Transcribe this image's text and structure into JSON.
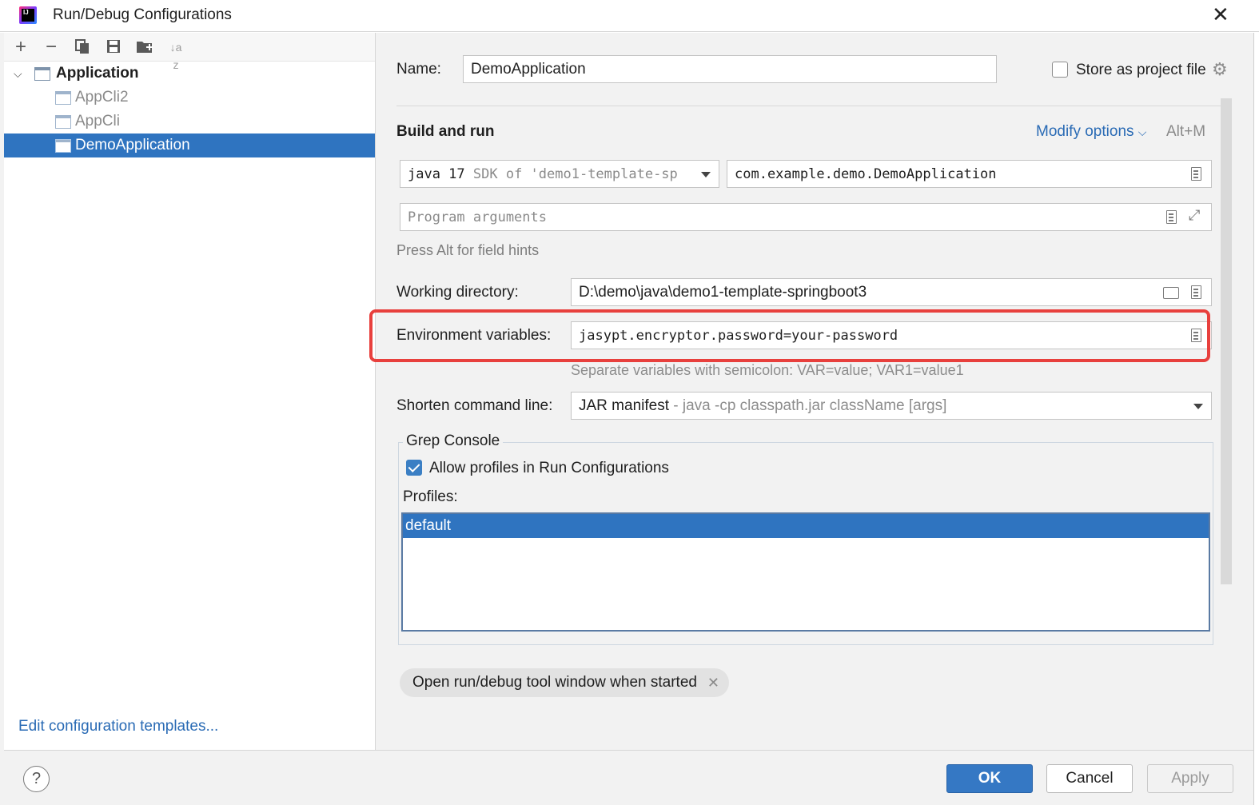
{
  "window": {
    "title": "Run/Debug Configurations",
    "app_icon_text": "IJ"
  },
  "toolbar": {
    "add": "+",
    "remove": "−",
    "copy": "⧉",
    "save": "💾",
    "folder": "📁",
    "sort": "↓a z"
  },
  "tree": {
    "group": "Application",
    "items": [
      {
        "label": "AppCli2"
      },
      {
        "label": "AppCli"
      },
      {
        "label": "DemoApplication"
      }
    ]
  },
  "left_footer": {
    "edit_templates": "Edit configuration templates..."
  },
  "form": {
    "name_label": "Name:",
    "name_value": "DemoApplication",
    "store_label": "Store as project file",
    "store_checked": false,
    "section_title": "Build and run",
    "modify_options": "Modify options",
    "modify_shortcut": "Alt+M",
    "sdk_value": "java 17",
    "sdk_detail": "SDK of 'demo1-template-sp",
    "main_class": "com.example.demo.DemoApplication",
    "program_args_placeholder": "Program arguments",
    "alt_hint": "Press Alt for field hints",
    "workdir_label": "Working directory:",
    "workdir_value": "D:\\demo\\java\\demo1-template-springboot3",
    "env_label": "Environment variables:",
    "env_value": "jasypt.encryptor.password=your-password",
    "env_hint": "Separate variables with semicolon: VAR=value; VAR1=value1",
    "shorten_label": "Shorten command line:",
    "shorten_value": "JAR manifest",
    "shorten_detail": "- java -cp classpath.jar className [args]",
    "grep_title": "Grep Console",
    "allow_profiles_label": "Allow profiles in Run Configurations",
    "allow_profiles_checked": true,
    "profiles_label": "Profiles:",
    "profiles": [
      "default"
    ],
    "chip_label": "Open run/debug tool window when started"
  },
  "buttons": {
    "help": "?",
    "ok": "OK",
    "cancel": "Cancel",
    "apply": "Apply"
  },
  "colors": {
    "accent": "#2f74c0",
    "link": "#2a6bb5",
    "highlight_box": "#e8403d"
  }
}
